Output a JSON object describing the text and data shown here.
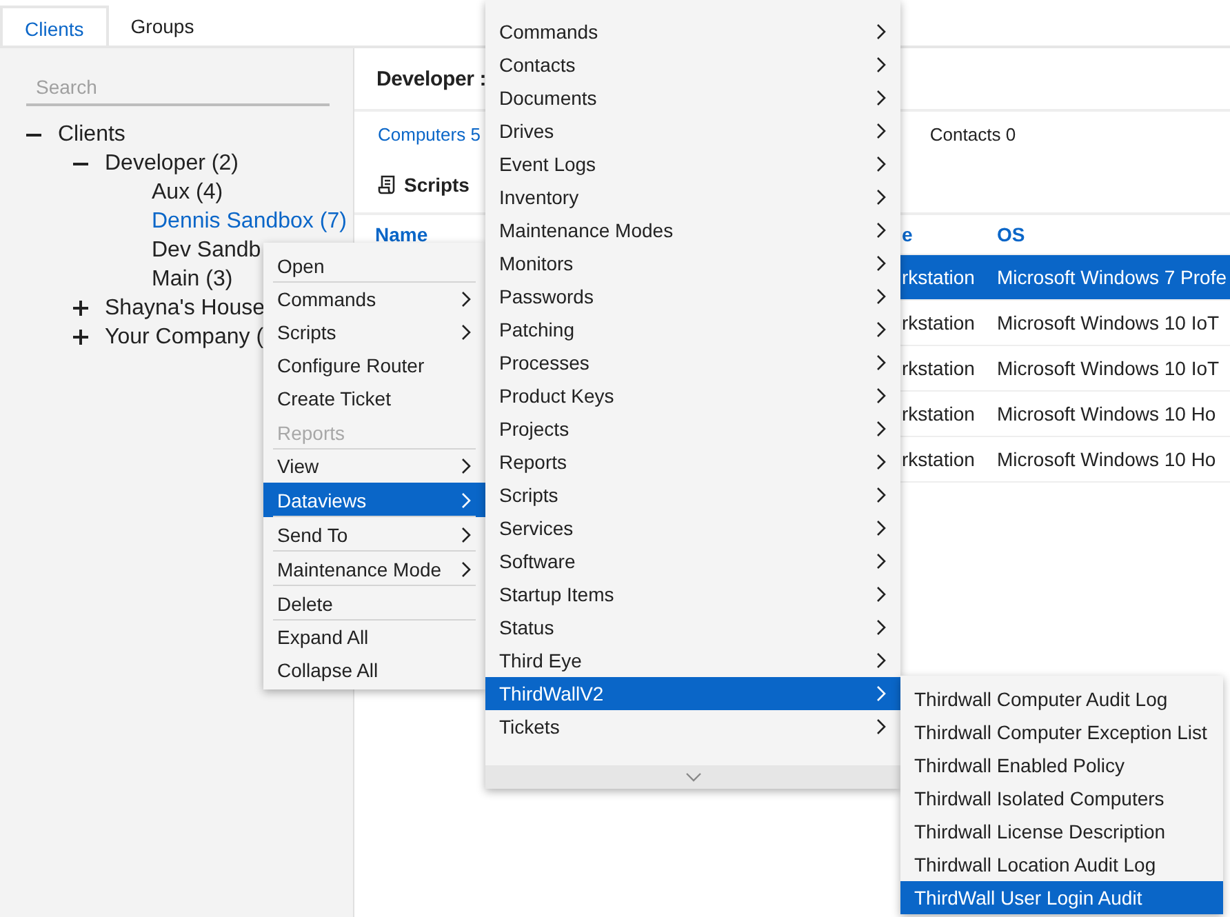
{
  "tabs": [
    {
      "label": "Clients",
      "selected": true
    },
    {
      "label": "Groups",
      "selected": false
    }
  ],
  "search": {
    "placeholder": "Search"
  },
  "tree": [
    {
      "label": "Clients",
      "expanded": true,
      "selected": false,
      "children": [
        {
          "label": "Developer (2)",
          "expanded": true,
          "selected": false,
          "children": [
            {
              "label": "Aux (4)",
              "selected": false
            },
            {
              "label": "Dennis Sandbox (7)",
              "selected": true
            },
            {
              "label": "Dev Sandb",
              "selected": false
            },
            {
              "label": "Main (3)",
              "selected": false
            }
          ]
        },
        {
          "label": "Shayna's House",
          "expanded": false,
          "selected": false
        },
        {
          "label": "Your Company (",
          "expanded": false,
          "selected": false
        }
      ]
    }
  ],
  "detail": {
    "title": "Developer :",
    "tabs": [
      {
        "label": "Computers 5",
        "selected": true
      },
      {
        "label": "Contacts 0",
        "selected": false
      }
    ],
    "section": "Scripts",
    "table": {
      "columns": [
        "Name",
        "e",
        "OS"
      ],
      "rows": [
        {
          "cells": [
            "",
            "rkstation",
            "Microsoft Windows 7 Profe"
          ],
          "selected": true
        },
        {
          "cells": [
            "",
            "rkstation",
            "Microsoft Windows 10 IoT"
          ],
          "selected": false
        },
        {
          "cells": [
            "",
            "rkstation",
            "Microsoft Windows 10 IoT"
          ],
          "selected": false
        },
        {
          "cells": [
            "",
            "rkstation",
            "Microsoft Windows 10 Ho"
          ],
          "selected": false
        },
        {
          "cells": [
            "",
            "rkstation",
            "Microsoft Windows 10 Ho"
          ],
          "selected": false
        }
      ]
    }
  },
  "context_menu": {
    "items": [
      {
        "label": "Open",
        "submenu": false,
        "disabled": false,
        "selected": false,
        "divider_after": true
      },
      {
        "label": "Commands",
        "submenu": true,
        "disabled": false,
        "selected": false,
        "divider_after": false
      },
      {
        "label": "Scripts",
        "submenu": true,
        "disabled": false,
        "selected": false,
        "divider_after": false
      },
      {
        "label": "Configure Router",
        "submenu": false,
        "disabled": false,
        "selected": false,
        "divider_after": false
      },
      {
        "label": "Create Ticket",
        "submenu": false,
        "disabled": false,
        "selected": false,
        "divider_after": false
      },
      {
        "label": "Reports",
        "submenu": false,
        "disabled": true,
        "selected": false,
        "divider_after": true
      },
      {
        "label": "View",
        "submenu": true,
        "disabled": false,
        "selected": false,
        "divider_after": false
      },
      {
        "label": "Dataviews",
        "submenu": true,
        "disabled": false,
        "selected": true,
        "divider_after": true
      },
      {
        "label": "Send To",
        "submenu": true,
        "disabled": false,
        "selected": false,
        "divider_after": true
      },
      {
        "label": "Maintenance Mode",
        "submenu": true,
        "disabled": false,
        "selected": false,
        "divider_after": true
      },
      {
        "label": "Delete",
        "submenu": false,
        "disabled": false,
        "selected": false,
        "divider_after": true
      },
      {
        "label": "Expand All",
        "submenu": false,
        "disabled": false,
        "selected": false,
        "divider_after": false
      },
      {
        "label": "Collapse All",
        "submenu": false,
        "disabled": false,
        "selected": false,
        "divider_after": false
      }
    ]
  },
  "dataviews_menu": {
    "more_below": true,
    "items": [
      {
        "label": "Commands",
        "submenu": true,
        "selected": false
      },
      {
        "label": "Contacts",
        "submenu": true,
        "selected": false
      },
      {
        "label": "Documents",
        "submenu": true,
        "selected": false
      },
      {
        "label": "Drives",
        "submenu": true,
        "selected": false
      },
      {
        "label": "Event Logs",
        "submenu": true,
        "selected": false
      },
      {
        "label": "Inventory",
        "submenu": true,
        "selected": false
      },
      {
        "label": "Maintenance Modes",
        "submenu": true,
        "selected": false
      },
      {
        "label": "Monitors",
        "submenu": true,
        "selected": false
      },
      {
        "label": "Passwords",
        "submenu": true,
        "selected": false
      },
      {
        "label": "Patching",
        "submenu": true,
        "selected": false
      },
      {
        "label": "Processes",
        "submenu": true,
        "selected": false
      },
      {
        "label": "Product Keys",
        "submenu": true,
        "selected": false
      },
      {
        "label": "Projects",
        "submenu": true,
        "selected": false
      },
      {
        "label": "Reports",
        "submenu": true,
        "selected": false
      },
      {
        "label": "Scripts",
        "submenu": true,
        "selected": false
      },
      {
        "label": "Services",
        "submenu": true,
        "selected": false
      },
      {
        "label": "Software",
        "submenu": true,
        "selected": false
      },
      {
        "label": "Startup Items",
        "submenu": true,
        "selected": false
      },
      {
        "label": "Status",
        "submenu": true,
        "selected": false
      },
      {
        "label": "Third Eye",
        "submenu": true,
        "selected": false
      },
      {
        "label": "ThirdWallV2",
        "submenu": true,
        "selected": true
      },
      {
        "label": "Tickets",
        "submenu": true,
        "selected": false
      }
    ]
  },
  "thirdwall_menu": {
    "items": [
      {
        "label": "Thirdwall Computer Audit Log",
        "selected": false
      },
      {
        "label": "Thirdwall Computer Exception List",
        "selected": false
      },
      {
        "label": "Thirdwall Enabled Policy",
        "selected": false
      },
      {
        "label": "Thirdwall Isolated Computers",
        "selected": false
      },
      {
        "label": "Thirdwall License Description",
        "selected": false
      },
      {
        "label": "Thirdwall Location Audit Log",
        "selected": false
      },
      {
        "label": "ThirdWall User Login Audit",
        "selected": true
      }
    ]
  }
}
